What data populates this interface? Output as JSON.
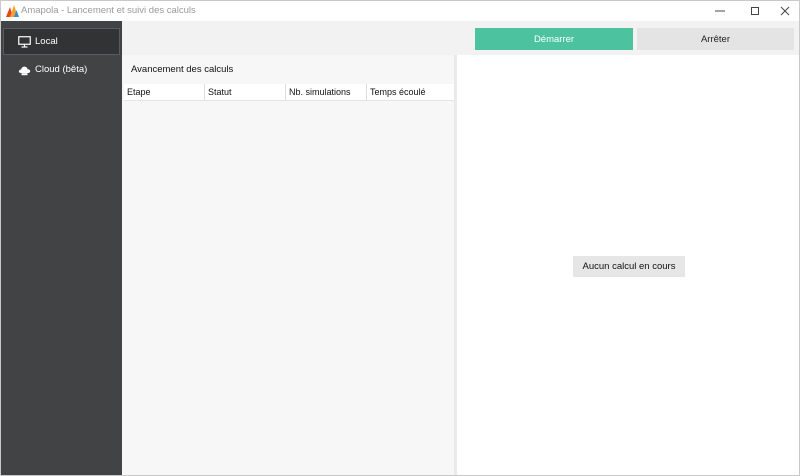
{
  "window": {
    "title": "Amapola - Lancement et suivi des calculs",
    "logo_colors": [
      "#e8431c",
      "#f4a32a",
      "#2f8fd6"
    ]
  },
  "sidebar": {
    "items": [
      {
        "label": "Local",
        "icon": "monitor-icon",
        "selected": true
      },
      {
        "label": "Cloud (bêta)",
        "icon": "cloud-icon",
        "selected": false
      }
    ]
  },
  "toolbar": {
    "start_label": "Démarrer",
    "stop_label": "Arrêter",
    "start_color": "#4cc39e"
  },
  "progress": {
    "title": "Avancement des calculs",
    "columns": [
      "Etape",
      "Statut",
      "Nb. simulations",
      "Temps écoulé"
    ],
    "rows": []
  },
  "details": {
    "empty_message": "Aucun calcul en cours"
  }
}
